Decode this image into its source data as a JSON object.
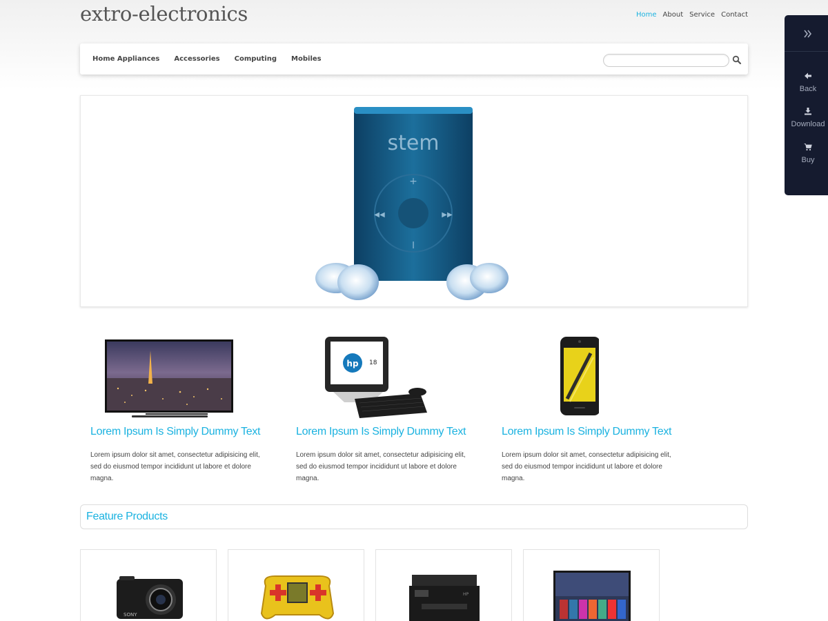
{
  "site": {
    "logo": "extro-electronics"
  },
  "top_nav": [
    {
      "label": "Home",
      "active": true
    },
    {
      "label": "About",
      "active": false
    },
    {
      "label": "Service",
      "active": false
    },
    {
      "label": "Contact",
      "active": false
    }
  ],
  "menu": [
    "Home Appliances",
    "Accessories",
    "Computing",
    "Mobiles"
  ],
  "search": {
    "placeholder": "",
    "icon": "search-icon"
  },
  "sidebar": {
    "toggle_icon": "double-chevron-right-icon",
    "items": [
      {
        "label": "Back",
        "icon": "arrow-left-icon"
      },
      {
        "label": "Download",
        "icon": "download-icon"
      },
      {
        "label": "Buy",
        "icon": "cart-icon"
      }
    ]
  },
  "hero": {
    "brand_text": "stem",
    "image": "mp3-player-with-earbuds"
  },
  "features": [
    {
      "image": "tv-night-city",
      "title": "Lorem Ipsum Is Simply Dummy Text",
      "text": "Lorem ipsum dolor sit amet, consectetur adipisicing elit, sed do eiusmod tempor incididunt ut labore et dolore magna."
    },
    {
      "image": "hp-all-in-one-pc",
      "title": "Lorem Ipsum Is Simply Dummy Text",
      "text": "Lorem ipsum dolor sit amet, consectetur adipisicing elit, sed do eiusmod tempor incididunt ut labore et dolore magna."
    },
    {
      "image": "yellow-smartphone",
      "title": "Lorem Ipsum Is Simply Dummy Text",
      "text": "Lorem ipsum dolor sit amet, consectetur adipisicing elit, sed do eiusmod tempor incididunt ut labore et dolore magna."
    }
  ],
  "feature_products": {
    "heading": "Feature Products",
    "items": [
      {
        "image": "sony-camera"
      },
      {
        "image": "game-controller"
      },
      {
        "image": "printer"
      },
      {
        "image": "smart-tv"
      }
    ]
  },
  "colors": {
    "accent": "#1ab2e0",
    "sidebar_bg": "#151b2f",
    "text": "#444444"
  }
}
